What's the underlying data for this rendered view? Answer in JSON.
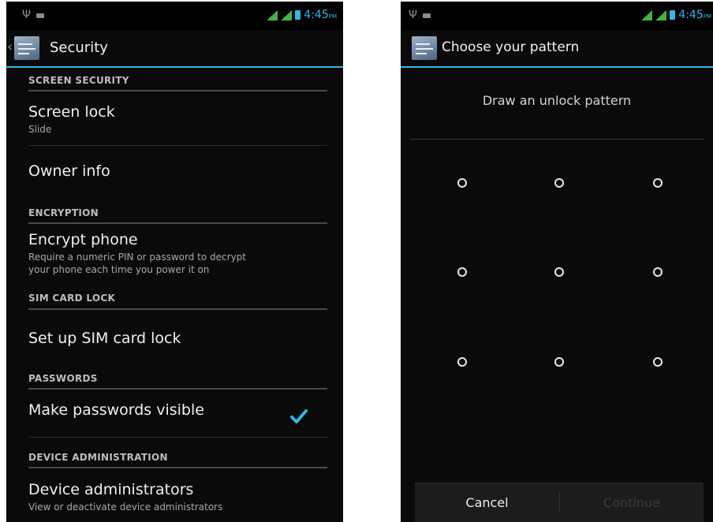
{
  "status_bar": {
    "time": "4:45",
    "ampm": "PM"
  },
  "security_screen": {
    "title": "Security",
    "sections": {
      "screen_security": "SCREEN SECURITY",
      "encryption": "ENCRYPTION",
      "sim_card_lock": "SIM CARD LOCK",
      "passwords": "PASSWORDS",
      "device_administration": "DEVICE ADMINISTRATION"
    },
    "items": {
      "screen_lock": {
        "title": "Screen lock",
        "summary": "Slide"
      },
      "owner_info": {
        "title": "Owner info"
      },
      "encrypt_phone": {
        "title": "Encrypt phone",
        "summary_line1": "Require a numeric PIN or password to decrypt",
        "summary_line2": "your phone each time you power it on"
      },
      "sim_lock": {
        "title": "Set up SIM card lock"
      },
      "passwords_visible": {
        "title": "Make passwords visible",
        "checked": true
      },
      "device_admins": {
        "title": "Device administrators",
        "summary": "View or deactivate device administrators"
      }
    }
  },
  "pattern_screen": {
    "title": "Choose your pattern",
    "prompt": "Draw an unlock pattern",
    "cancel_label": "Cancel",
    "continue_label": "Continue",
    "continue_enabled": false
  },
  "colors": {
    "accent": "#33b5e5",
    "background": "#0a0a0a",
    "signal": "#46b045"
  }
}
